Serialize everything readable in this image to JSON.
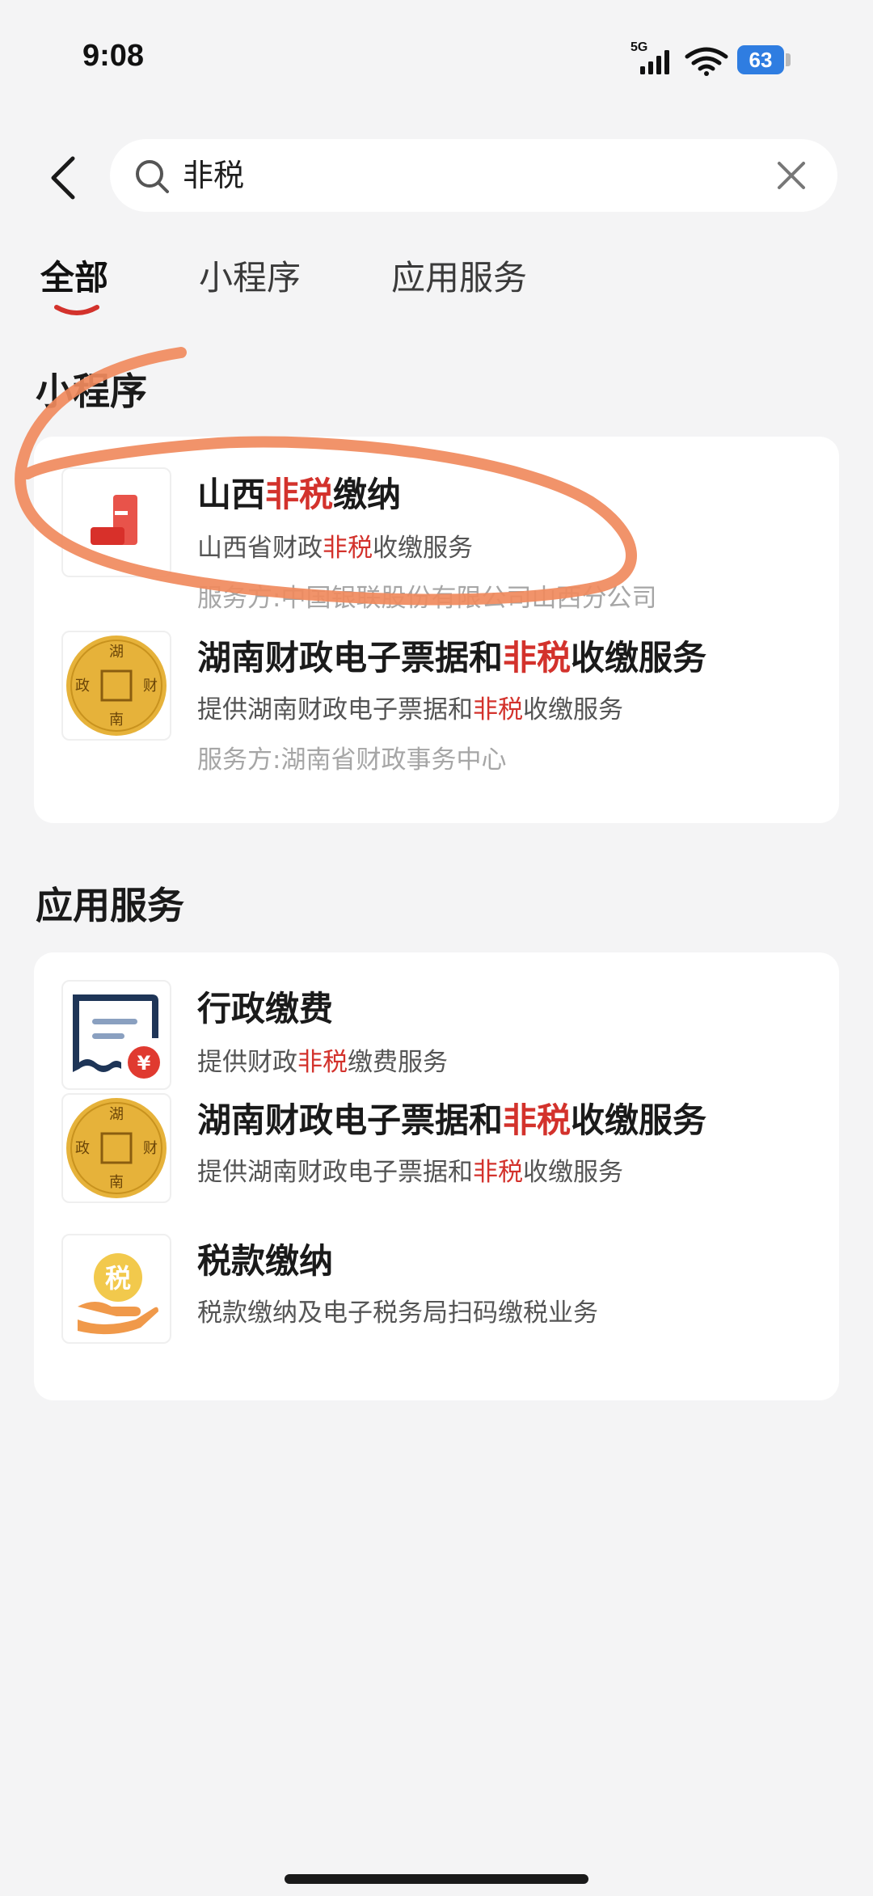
{
  "status_bar": {
    "time": "9:08",
    "network": "5G",
    "battery": "63"
  },
  "search": {
    "query": "非税"
  },
  "tabs": [
    {
      "label": "全部",
      "active": true
    },
    {
      "label": "小程序",
      "active": false
    },
    {
      "label": "应用服务",
      "active": false
    }
  ],
  "sections": {
    "mini_programs": {
      "title": "小程序",
      "items": [
        {
          "icon": "document-red-icon",
          "title_pre": "山西",
          "title_hl": "非税",
          "title_post": "缴纳",
          "desc_pre": "山西省财政",
          "desc_hl": "非税",
          "desc_post": "收缴服务",
          "provider": "服务方:中国银联股份有限公司山西分公司"
        },
        {
          "icon": "gold-seal-icon",
          "title_pre": "湖南财政电子票据和",
          "title_hl": "非税",
          "title_post": "收缴服务",
          "desc_pre": "提供湖南财政电子票据和",
          "desc_hl": "非税",
          "desc_post": "收缴服务",
          "provider": "服务方:湖南省财政事务中心"
        }
      ]
    },
    "app_services": {
      "title": "应用服务",
      "items": [
        {
          "icon": "receipt-yuan-icon",
          "title": "行政缴费",
          "desc_pre": "提供财政",
          "desc_hl": "非税",
          "desc_post": "缴费服务"
        },
        {
          "icon": "gold-seal-icon",
          "title_pre": "湖南财政电子票据和",
          "title_hl": "非税",
          "title_post": "收缴服务",
          "desc_pre": "提供湖南财政电子票据和",
          "desc_hl": "非税",
          "desc_post": "收缴服务"
        },
        {
          "icon": "tax-hand-icon",
          "title": "税款缴纳",
          "desc": "税款缴纳及电子税务局扫码缴税业务"
        }
      ]
    }
  },
  "seal_text": {
    "top": "湖",
    "bottom": "南",
    "left": "政",
    "right": "财"
  },
  "tax_icon_char": "税",
  "colors": {
    "highlight": "#d3322c",
    "accent": "#e63b2e",
    "battery": "#2f7de1",
    "annotation": "#f08a5d"
  }
}
